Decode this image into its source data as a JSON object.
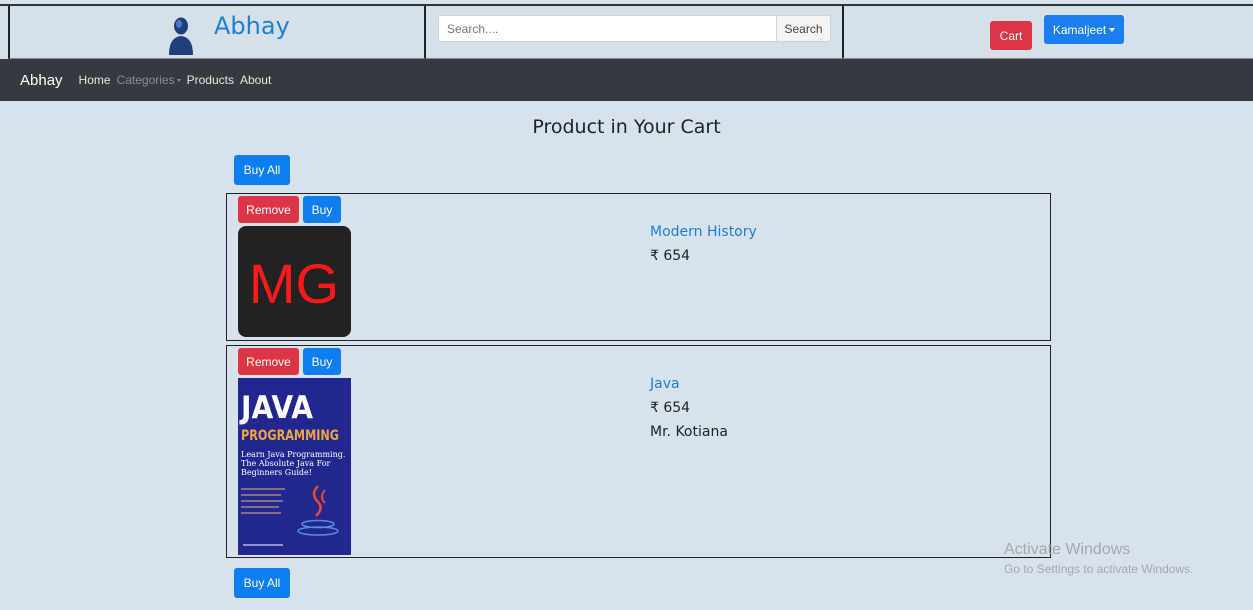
{
  "header": {
    "brand": "Abhay",
    "search": {
      "placeholder": "Search....",
      "button": "Search"
    },
    "cart_label": "Cart",
    "user_label": "Kamaljeet"
  },
  "navbar": {
    "brand": "Abhay",
    "links": [
      "Home",
      "Categories",
      "Products",
      "About"
    ]
  },
  "page": {
    "title": "Product in Your Cart",
    "buy_all": "Buy All"
  },
  "cart": [
    {
      "remove": "Remove",
      "buy": "Buy",
      "name": "Modern History",
      "price": "₹ 654",
      "author": "",
      "cover_text": "MG"
    },
    {
      "remove": "Remove",
      "buy": "Buy",
      "name": "Java",
      "price": "₹ 654",
      "author": "Mr. Kotiana",
      "cover_text": [
        "JAVA",
        "PROGRAMMING",
        "Learn Java Programming.",
        "The Absolute Java For",
        "Beginners Guide!"
      ]
    }
  ],
  "watermark": {
    "line1": "Activate Windows",
    "line2": "Go to Settings to activate Windows."
  },
  "colors": {
    "primary": "#0d7ef0",
    "danger": "#dc3545",
    "navbar": "#343a40",
    "background": "#d8e2ec"
  },
  "icons": {
    "avatar": "user-avatar-icon",
    "caret": "chevron-down-icon"
  }
}
